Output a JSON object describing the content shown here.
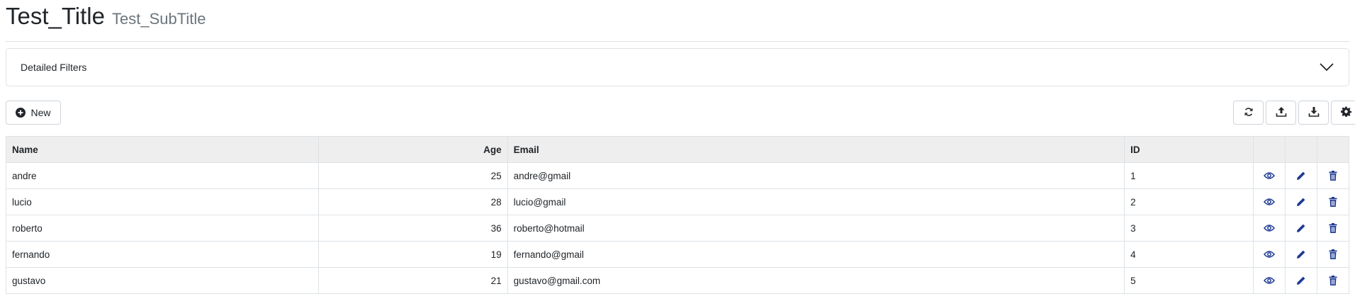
{
  "header": {
    "title": "Test_Title",
    "subtitle": "Test_SubTitle"
  },
  "filters": {
    "label": "Detailed Filters",
    "icon": "chevron-down-icon"
  },
  "toolbar": {
    "new_label": "New",
    "icons": [
      "refresh-icon",
      "upload-icon",
      "download-icon",
      "gear-icon"
    ]
  },
  "table": {
    "columns": [
      "Name",
      "Age",
      "Email",
      "ID"
    ],
    "rows": [
      {
        "name": "andre",
        "age": "25",
        "email": "andre@gmail",
        "id": "1"
      },
      {
        "name": "lucio",
        "age": "28",
        "email": "lucio@gmail",
        "id": "2"
      },
      {
        "name": "roberto",
        "age": "36",
        "email": "roberto@hotmail",
        "id": "3"
      },
      {
        "name": "fernando",
        "age": "19",
        "email": "fernando@gmail",
        "id": "4"
      },
      {
        "name": "gustavo",
        "age": "21",
        "email": "gustavo@gmail.com",
        "id": "5"
      }
    ],
    "row_actions": [
      "view-icon",
      "edit-icon",
      "delete-icon"
    ]
  },
  "colors": {
    "accent": "#1f3a93",
    "header_bg": "#eeeeee",
    "border": "#dee2e6"
  }
}
